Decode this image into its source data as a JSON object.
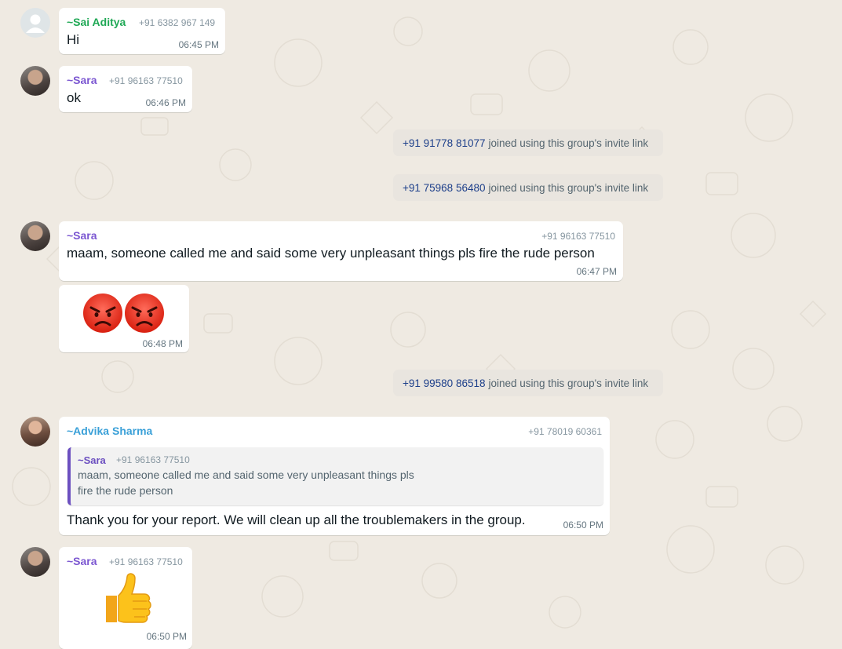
{
  "colors": {
    "chat_bg": "#efeae2",
    "bubble": "#ffffff",
    "system_bg": "#e9e5df",
    "link_number": "#1d3f8a",
    "quote_bar": "#6b4fc0"
  },
  "messages": [
    {
      "sender": "~Sai Aditya",
      "phone": "+91 6382 967 149",
      "text": "Hi",
      "time": "06:45 PM",
      "sender_color": "#1fa855"
    },
    {
      "sender": "~Sara",
      "phone": "+91 96163 77510",
      "text": "ok",
      "time": "06:46 PM",
      "sender_color": "#7b56d1"
    },
    {
      "sender": "~Sara",
      "phone": "+91 96163 77510",
      "text": "maam, someone called me and said some very unpleasant things pls fire the rude person",
      "time": "06:47 PM",
      "sender_color": "#7b56d1"
    },
    {
      "emoji": "angry-face-emoji x2",
      "time": "06:48 PM"
    },
    {
      "sender": "~Advika Sharma",
      "phone": "+91 78019 60361",
      "text": "Thank you for your report. We will clean up all the troublemakers in the group.",
      "time": "06:50 PM",
      "sender_color": "#3aa0d8",
      "quote": {
        "sender": "~Sara",
        "phone": "+91 96163 77510",
        "line1": "maam, someone called me and said some very unpleasant things pls",
        "line2": "fire the rude person"
      }
    },
    {
      "sender": "~Sara",
      "phone": "+91 96163 77510",
      "emoji": "thumbs-up-emoji",
      "time": "06:50 PM",
      "sender_color": "#7b56d1"
    }
  ],
  "system": [
    {
      "number": "+91 91778 81077",
      "text": "joined using this group's invite link"
    },
    {
      "number": "+91 75968 56480",
      "text": "joined using this group's invite link"
    },
    {
      "number": "+91 99580 86518",
      "text": "joined using this group's invite link"
    }
  ]
}
